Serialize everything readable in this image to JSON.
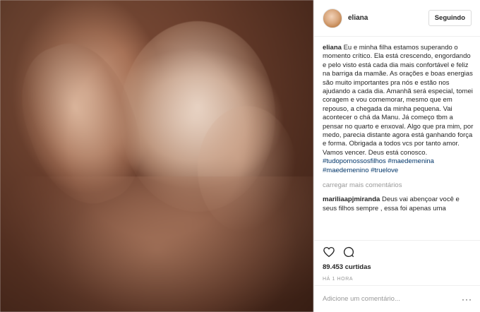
{
  "post": {
    "image_alt": "ultrasound",
    "author": "eliana",
    "follow_label": "Seguindo",
    "caption_user": "eliana",
    "caption_text": " Eu e minha filha estamos superando o momento crítico. Ela está crescendo, engordando e pelo visto está cada dia mais confortável e feliz na barriga da mamãe. As orações e boas energias são muito importantes pra nós e estão nos ajudando a cada dia. Amanhã será especial, tomei coragem e vou comemorar, mesmo que em repouso, a chegada da minha pequena. Vai acontecer o chá da Manu. Já começo tbm a pensar no quarto e enxoval. Algo que pra mim, por medo, parecia distante agora está ganhando força e forma. Obrigada a todos vcs por tanto amor. Vamos vencer. Deus está conosco.",
    "hashtags": "#tudopornossosfilhos #maedemenina #maedemenino #truelove",
    "load_more": "carregar mais comentários",
    "comment_user": "mariliaapjmiranda",
    "comment_text": " Deus vai abençoar você e seus filhos sempre , essa foi apenas uma",
    "likes": "89.453 curtidas",
    "time": "HÁ 1 HORA",
    "comment_placeholder": "Adicione um comentário...",
    "more_label": "···"
  },
  "icons": {
    "like": "heart-icon",
    "comment": "comment-icon",
    "more": "more-options-icon"
  }
}
